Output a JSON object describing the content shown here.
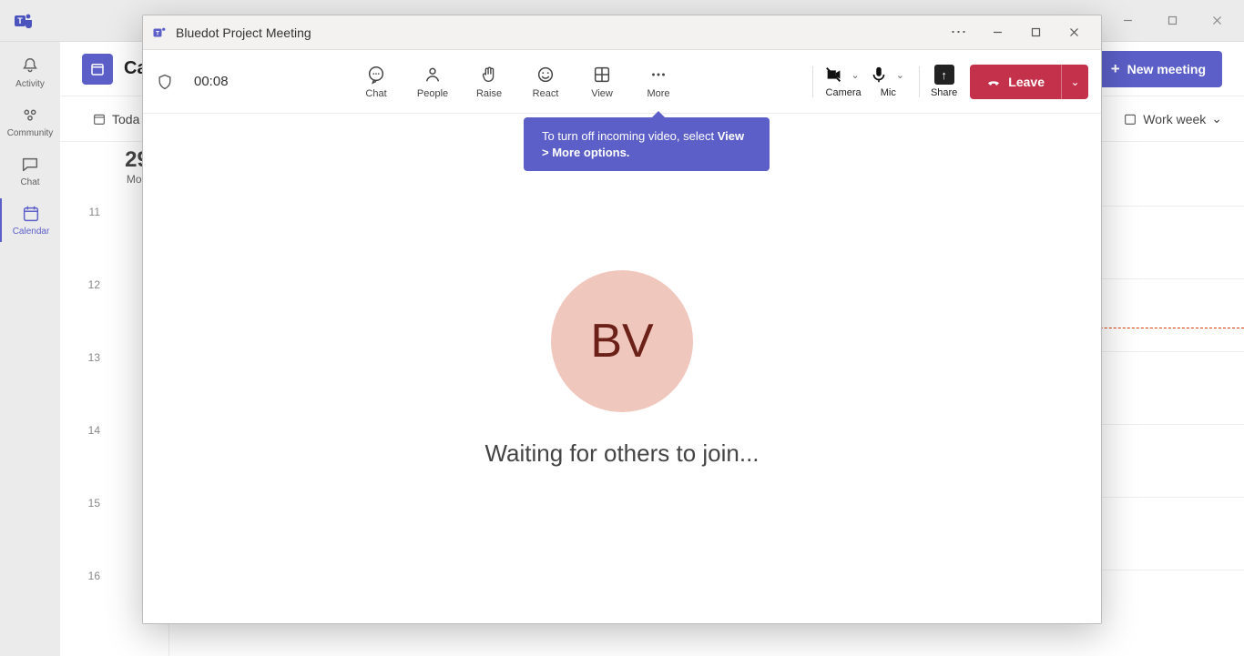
{
  "sidebar": {
    "items": [
      {
        "label": "Activity"
      },
      {
        "label": "Community"
      },
      {
        "label": "Chat"
      },
      {
        "label": "Calendar"
      }
    ]
  },
  "calendar": {
    "title_partial": "Ca",
    "new_meeting": "New meeting",
    "today": "Toda",
    "work_week": "Work week",
    "day_number": "29",
    "day_name": "Mon",
    "hours": [
      "11",
      "12",
      "13",
      "14",
      "15",
      "16"
    ]
  },
  "meeting": {
    "title": "Bluedot Project Meeting",
    "timer": "00:08",
    "toolbar": {
      "chat": "Chat",
      "people": "People",
      "raise": "Raise",
      "react": "React",
      "view": "View",
      "more": "More",
      "camera": "Camera",
      "mic": "Mic",
      "share": "Share",
      "leave": "Leave"
    },
    "tooltip": {
      "line1a": "To turn off incoming video, select ",
      "line1b": "View > More options."
    },
    "avatar_initials": "BV",
    "waiting_text": "Waiting for others to join..."
  }
}
